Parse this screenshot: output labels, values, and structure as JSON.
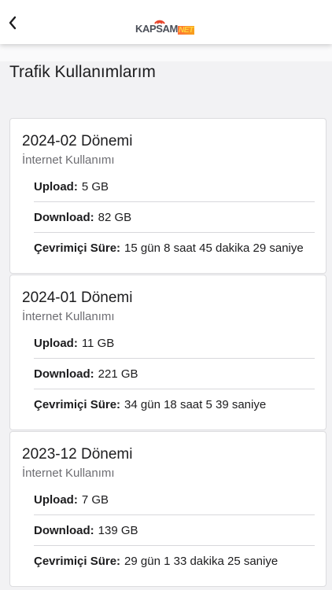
{
  "header": {
    "back_icon": "chevron-left-icon",
    "logo": {
      "part1": "KAPSAM",
      "part2": "NET"
    }
  },
  "page": {
    "title": "Trafik Kullanımlarım"
  },
  "periods": [
    {
      "title": "2024-02 Dönemi",
      "subtitle": "İnternet Kullanımı",
      "upload_label": "Upload:",
      "upload_value": "5 GB",
      "download_label": "Download:",
      "download_value": "82 GB",
      "online_label": "Çevrimiçi Süre:",
      "online_value": "15 gün 8 saat 45 dakika 29 saniye"
    },
    {
      "title": "2024-01 Dönemi",
      "subtitle": "İnternet Kullanımı",
      "upload_label": "Upload:",
      "upload_value": "11 GB",
      "download_label": "Download:",
      "download_value": "221 GB",
      "online_label": "Çevrimiçi Süre:",
      "online_value": "34 gün 18 saat 5 39 saniye"
    },
    {
      "title": "2023-12 Dönemi",
      "subtitle": "İnternet Kullanımı",
      "upload_label": "Upload:",
      "upload_value": "7 GB",
      "download_label": "Download:",
      "download_value": "139 GB",
      "online_label": "Çevrimiçi Süre:",
      "online_value": "29 gün 1 33 dakika 25 saniye"
    }
  ]
}
